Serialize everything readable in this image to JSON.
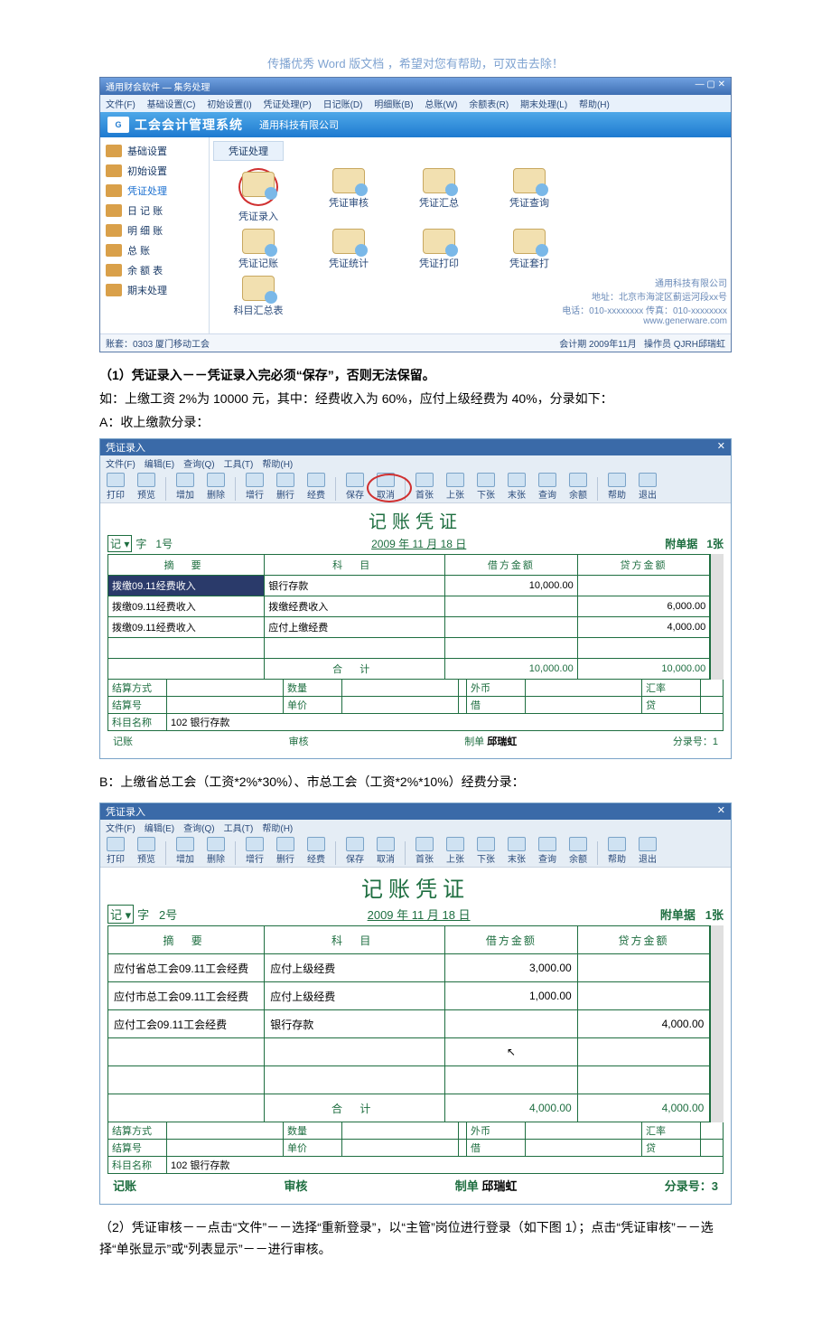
{
  "header_note": "传播优秀 Word 版文档 ，希望对您有帮助，可双击去除！",
  "app": {
    "window_title": "通用财会软件 — 集务处理",
    "menu": [
      "文件(F)",
      "基础设置(C)",
      "初始设置(I)",
      "凭证处理(P)",
      "日记账(D)",
      "明细账(B)",
      "总账(W)",
      "余额表(R)",
      "期末处理(L)",
      "帮助(H)"
    ],
    "banner_title": "工会会计管理系统",
    "banner_sub": "通用科技有限公司",
    "sidebar": [
      "基础设置",
      "初始设置",
      "凭证处理",
      "日 记 账",
      "明 细 账",
      "总    账",
      "余 额 表",
      "期末处理"
    ],
    "sidebar_active_index": 2,
    "group_title": "凭证处理",
    "icons_row1": [
      "凭证录入",
      "凭证审核",
      "凭证汇总",
      "凭证查询"
    ],
    "icons_row2": [
      "凭证记账",
      "凭证统计",
      "凭证打印",
      "凭证套打"
    ],
    "icons_row3": [
      "科目汇总表"
    ],
    "company_line": "通用科技有限公司",
    "addr_line": "地址：北京市海淀区蓟运河段xx号",
    "tel_line": "电话：010-xxxxxxxx 传真：010-xxxxxxxx",
    "url_line": "www.generware.com",
    "status_left": "账套：0303 厦门移动工会",
    "status_mid": "会计期 2009年11月",
    "status_right": "操作员  QJRH邱瑞虹"
  },
  "p1_bold": "（1）凭证录入－－凭证录入完必须“保存”，否则无法保留。",
  "p1_line2": "如：上缴工资 2%为 10000 元，其中：经费收入为 60%，应付上级经费为 40%，分录如下：",
  "p1_line3": "A：收上缴款分录：",
  "voucherA": {
    "win_title": "凭证录入",
    "menubar": [
      "文件(F)",
      "编辑(E)",
      "查询(Q)",
      "工具(T)",
      "帮助(H)"
    ],
    "toolbar": [
      "打印",
      "预览",
      "增加",
      "删除",
      "增行",
      "删行",
      "经费",
      "保存",
      "取消",
      "首张",
      "上张",
      "下张",
      "末张",
      "查询",
      "余额",
      "帮助",
      "退出"
    ],
    "title": "记账凭证",
    "word_prefix": "记",
    "word_suffix": "字",
    "number": "1号",
    "date": "2009 年 11 月 18 日",
    "attach_label": "附单据",
    "attach_count": "1张",
    "cols": [
      "摘    要",
      "科    目",
      "借方金额",
      "贷方金额"
    ],
    "rows": [
      {
        "summary": "拨缴09.11经费收入",
        "subject": "银行存款",
        "debit": "10,000.00",
        "credit": "",
        "sel": true
      },
      {
        "summary": "拨缴09.11经费收入",
        "subject": "拨缴经费收入",
        "debit": "",
        "credit": "6,000.00"
      },
      {
        "summary": "拨缴09.11经费收入",
        "subject": "应付上缴经费",
        "debit": "",
        "credit": "4,000.00"
      },
      {
        "summary": "",
        "subject": "",
        "debit": "",
        "credit": ""
      }
    ],
    "total_label": "合    计",
    "total_debit": "10,000.00",
    "total_credit": "10,000.00",
    "info": {
      "settle": "结算方式",
      "settle_v": "",
      "num": "结算号",
      "num_v": "",
      "acct": "科目名称",
      "acct_v": "102   银行存款",
      "qty": "数量",
      "qty_v": "",
      "price": "单价",
      "price_v": "",
      "fc": "外币",
      "fc_v": "",
      "rate": "汇率",
      "rate_v": "",
      "d": "借",
      "d_v": "",
      "c": "贷",
      "c_v": ""
    },
    "foot": {
      "post": "记账",
      "check": "审核",
      "make_lab": "制单",
      "make": "邱瑞虹",
      "seq": "分录号：1"
    }
  },
  "pB": "B：上缴省总工会（工资*2%*30%）、市总工会（工资*2%*10%）经费分录：",
  "voucherB": {
    "win_title": "凭证录入",
    "menubar": [
      "文件(F)",
      "编辑(E)",
      "查询(Q)",
      "工具(T)",
      "帮助(H)"
    ],
    "toolbar": [
      "打印",
      "预览",
      "增加",
      "删除",
      "增行",
      "删行",
      "经费",
      "保存",
      "取消",
      "首张",
      "上张",
      "下张",
      "末张",
      "查询",
      "余额",
      "帮助",
      "退出"
    ],
    "title": "记账凭证",
    "word_prefix": "记",
    "word_suffix": "字",
    "number": "2号",
    "date": "2009 年 11 月 18 日",
    "attach_label": "附单据",
    "attach_count": "1张",
    "cols": [
      "摘    要",
      "科    目",
      "借方金额",
      "贷方金额"
    ],
    "rows": [
      {
        "summary": "应付省总工会09.11工会经费",
        "subject": "应付上级经费",
        "debit": "3,000.00",
        "credit": ""
      },
      {
        "summary": "应付市总工会09.11工会经费",
        "subject": "应付上级经费",
        "debit": "1,000.00",
        "credit": ""
      },
      {
        "summary": "应付工会09.11工会经费",
        "subject": "银行存款",
        "debit": "",
        "credit": "4,000.00"
      },
      {
        "summary": "",
        "subject": "",
        "debit": "",
        "credit": ""
      },
      {
        "summary": "",
        "subject": "",
        "debit": "",
        "credit": ""
      }
    ],
    "total_label": "合    计",
    "total_debit": "4,000.00",
    "total_credit": "4,000.00",
    "info": {
      "settle": "结算方式",
      "settle_v": "",
      "num": "结算号",
      "num_v": "",
      "acct": "科目名称",
      "acct_v": "102   银行存款",
      "qty": "数量",
      "qty_v": "",
      "price": "单价",
      "price_v": "",
      "fc": "外币",
      "fc_v": "",
      "rate": "汇率",
      "rate_v": "",
      "d": "借",
      "d_v": "",
      "c": "贷",
      "c_v": ""
    },
    "foot": {
      "post": "记账",
      "check": "审核",
      "make_lab": "制单",
      "make": "邱瑞虹",
      "seq": "分录号：3"
    }
  },
  "p2": "（2）凭证审核－－点击“文件”－－选择“重新登录”，以“主管”岗位进行登录（如下图 1）；点击“凭证审核”－－选择“单张显示”或“列表显示”－－进行审核。"
}
